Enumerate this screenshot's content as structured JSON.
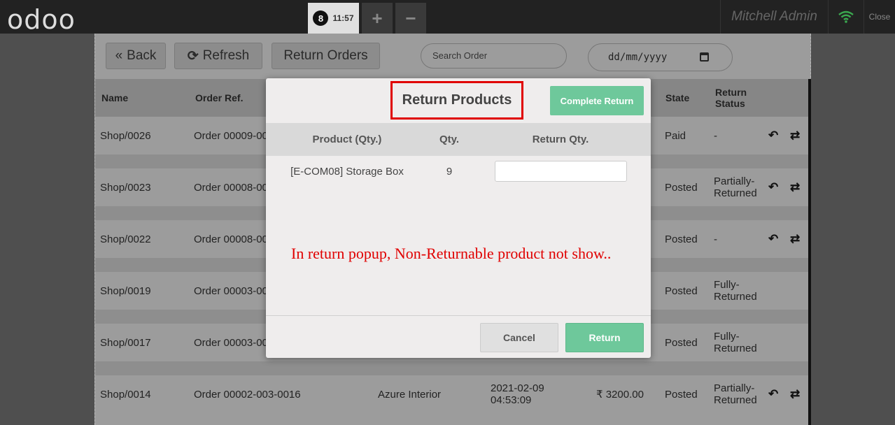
{
  "topbar": {
    "logo": "odoo",
    "order_number": "8",
    "order_time": "11:57",
    "add_label": "+",
    "remove_label": "−",
    "user": "Mitchell Admin",
    "close_label": "Close",
    "wifi_color": "#3aa84f"
  },
  "controls": {
    "back_label": "Back",
    "refresh_label": "Refresh",
    "return_orders_label": "Return Orders",
    "search_placeholder": "Search Order",
    "date_placeholder": "dd/mm/yyyy"
  },
  "table": {
    "headers": {
      "name": "Name",
      "order_ref": "Order Ref.",
      "state": "State",
      "return_status": "Return Status"
    },
    "rows": [
      {
        "name": "Shop/0026",
        "order_ref": "Order 00009-00",
        "customer": "",
        "date": "",
        "amount": "",
        "state": "Paid",
        "return_status": "-",
        "return_icon": "↶",
        "exchange_icon": "⇄"
      },
      {
        "name": "Shop/0023",
        "order_ref": "Order 00008-00",
        "customer": "",
        "date": "",
        "amount": "",
        "state": "Posted",
        "return_status": "Partially-Returned",
        "return_icon": "↶",
        "exchange_icon": "⇄"
      },
      {
        "name": "Shop/0022",
        "order_ref": "Order 00008-00",
        "customer": "",
        "date": "",
        "amount": "",
        "state": "Posted",
        "return_status": "-",
        "return_icon": "↶",
        "exchange_icon": "⇄"
      },
      {
        "name": "Shop/0019",
        "order_ref": "Order 00003-00",
        "customer": "",
        "date": "",
        "amount": "",
        "state": "Posted",
        "return_status": "Fully-Returned",
        "return_icon": "",
        "exchange_icon": ""
      },
      {
        "name": "Shop/0017",
        "order_ref": "Order 00003-00",
        "customer": "",
        "date": "",
        "amount": "",
        "state": "Posted",
        "return_status": "Fully-Returned",
        "return_icon": "",
        "exchange_icon": ""
      },
      {
        "name": "Shop/0014",
        "order_ref": "Order 00002-003-0016",
        "customer": "Azure Interior",
        "date": "2021-02-09 04:53:09",
        "amount": "₹ 3200.00",
        "state": "Posted",
        "return_status": "Partially-Returned",
        "return_icon": "↶",
        "exchange_icon": "⇄"
      }
    ]
  },
  "modal": {
    "title": "Return Products",
    "complete_return_label": "Complete Return",
    "headers": {
      "product": "Product (Qty.)",
      "qty": "Qty.",
      "return_qty": "Return Qty."
    },
    "lines": [
      {
        "product": "[E-COM08] Storage Box",
        "qty": "9",
        "return_qty": ""
      }
    ],
    "annotation": "In return popup, Non-Returnable product not show..",
    "cancel_label": "Cancel",
    "return_label": "Return"
  }
}
